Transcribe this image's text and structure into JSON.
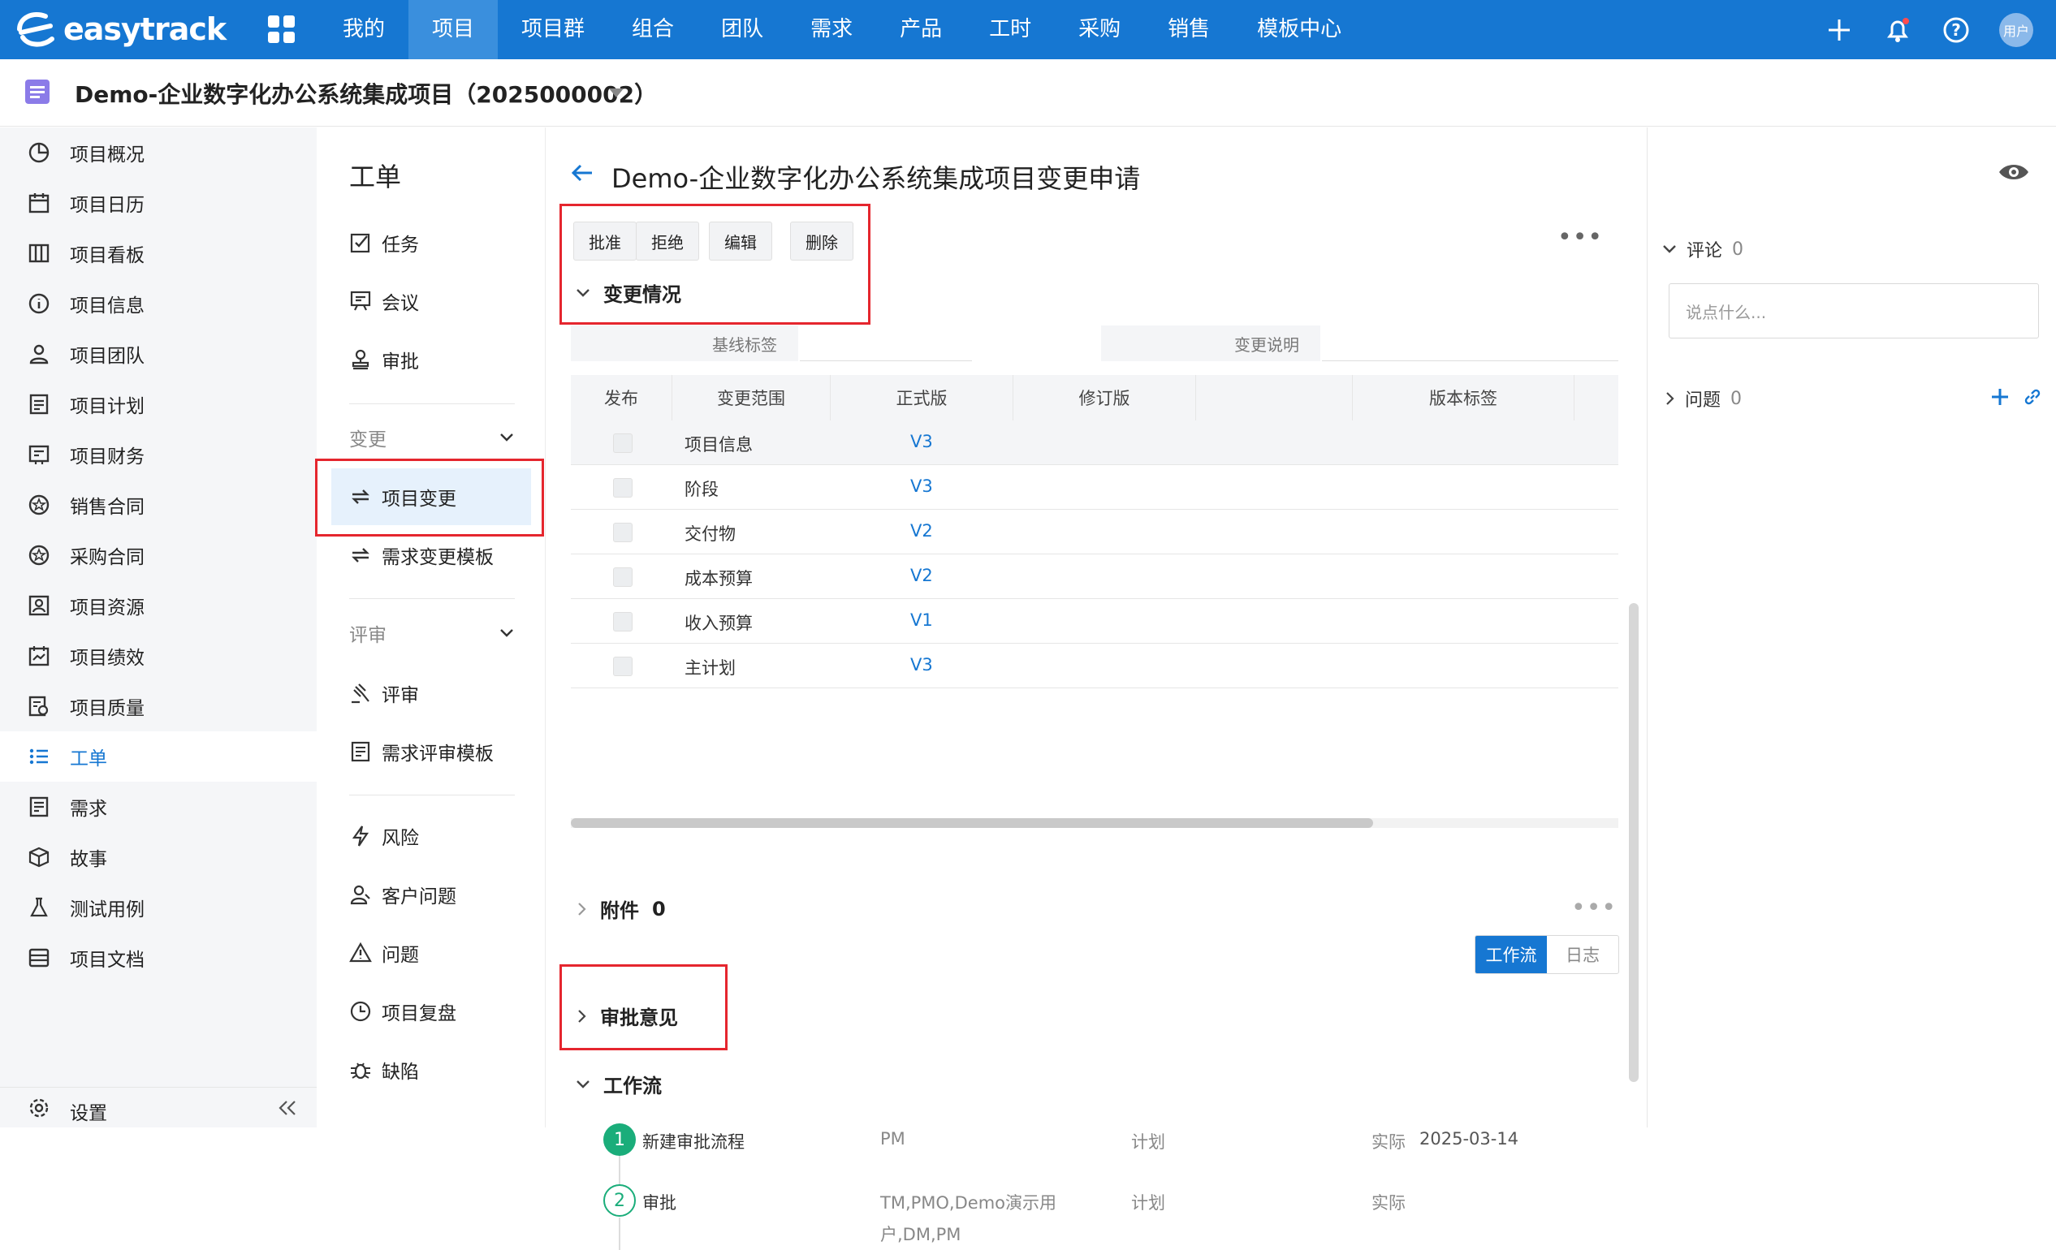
{
  "brand": {
    "name": "easytrack"
  },
  "topnav": {
    "items": [
      "我的",
      "项目",
      "项目群",
      "组合",
      "团队",
      "需求",
      "产品",
      "工时",
      "采购",
      "销售",
      "模板中心"
    ],
    "active_index": 1,
    "user_label": "用户"
  },
  "project": {
    "title": "Demo-企业数字化办公系统集成项目（2025000002）"
  },
  "sidebar": {
    "items": [
      {
        "label": "项目概况",
        "icon": "pie-chart-icon"
      },
      {
        "label": "项目日历",
        "icon": "calendar-icon"
      },
      {
        "label": "项目看板",
        "icon": "kanban-icon"
      },
      {
        "label": "项目信息",
        "icon": "info-icon"
      },
      {
        "label": "项目团队",
        "icon": "team-icon"
      },
      {
        "label": "项目计划",
        "icon": "plan-icon"
      },
      {
        "label": "项目财务",
        "icon": "finance-icon"
      },
      {
        "label": "销售合同",
        "icon": "contract-icon"
      },
      {
        "label": "采购合同",
        "icon": "contract-icon"
      },
      {
        "label": "项目资源",
        "icon": "resource-icon"
      },
      {
        "label": "项目绩效",
        "icon": "performance-icon"
      },
      {
        "label": "项目质量",
        "icon": "quality-icon"
      },
      {
        "label": "工单",
        "icon": "list-icon"
      },
      {
        "label": "需求",
        "icon": "requirement-icon"
      },
      {
        "label": "故事",
        "icon": "box-icon"
      },
      {
        "label": "测试用例",
        "icon": "flask-icon"
      },
      {
        "label": "项目文档",
        "icon": "doc-icon"
      }
    ],
    "active_index": 12,
    "settings_label": "设置"
  },
  "subnav": {
    "title": "工单",
    "top_items": [
      "任务",
      "会议",
      "审批"
    ],
    "group_change": "变更",
    "change_items": [
      "项目变更",
      "需求变更模板"
    ],
    "group_review": "评审",
    "review_items": [
      "评审",
      "需求评审模板"
    ],
    "bottom_items": [
      "风险",
      "客户问题",
      "问题",
      "项目复盘",
      "缺陷"
    ]
  },
  "main": {
    "title": "Demo-企业数字化办公系统集成项目变更申请",
    "buttons": {
      "approve": "批准",
      "reject": "拒绝",
      "edit": "编辑",
      "delete": "删除"
    },
    "section_change": "变更情况",
    "baseline_label": "基线标签",
    "change_desc_label": "变更说明",
    "table": {
      "headers": [
        "发布",
        "变更范围",
        "正式版",
        "修订版",
        "",
        "版本标签"
      ],
      "rows": [
        {
          "scope": "项目信息",
          "version": "V3"
        },
        {
          "scope": "阶段",
          "version": "V3"
        },
        {
          "scope": "交付物",
          "version": "V2"
        },
        {
          "scope": "成本预算",
          "version": "V2"
        },
        {
          "scope": "收入预算",
          "version": "V1"
        },
        {
          "scope": "主计划",
          "version": "V3"
        }
      ]
    },
    "attachments": {
      "label": "附件",
      "count": "0"
    },
    "approval_opinion": "审批意见",
    "workflow": {
      "label": "工作流",
      "tab_workflow": "工作流",
      "tab_log": "日志",
      "steps": [
        {
          "num": "1",
          "name": "新建审批流程",
          "who": "PM",
          "plan": "计划",
          "actual_label": "实际",
          "actual_date": "2025-03-14"
        },
        {
          "num": "2",
          "name": "审批",
          "who_line1": "TM,PMO,Demo演示用",
          "who_line2": "户,DM,PM",
          "plan": "计划",
          "actual_label": "实际"
        }
      ]
    }
  },
  "right_panel": {
    "comments_label": "评论",
    "comments_count": "0",
    "comment_placeholder": "说点什么...",
    "issues_label": "问题",
    "issues_count": "0"
  },
  "colors": {
    "primary": "#1677d2",
    "highlight_box": "#e5262e",
    "step_green": "#1aad7a"
  }
}
